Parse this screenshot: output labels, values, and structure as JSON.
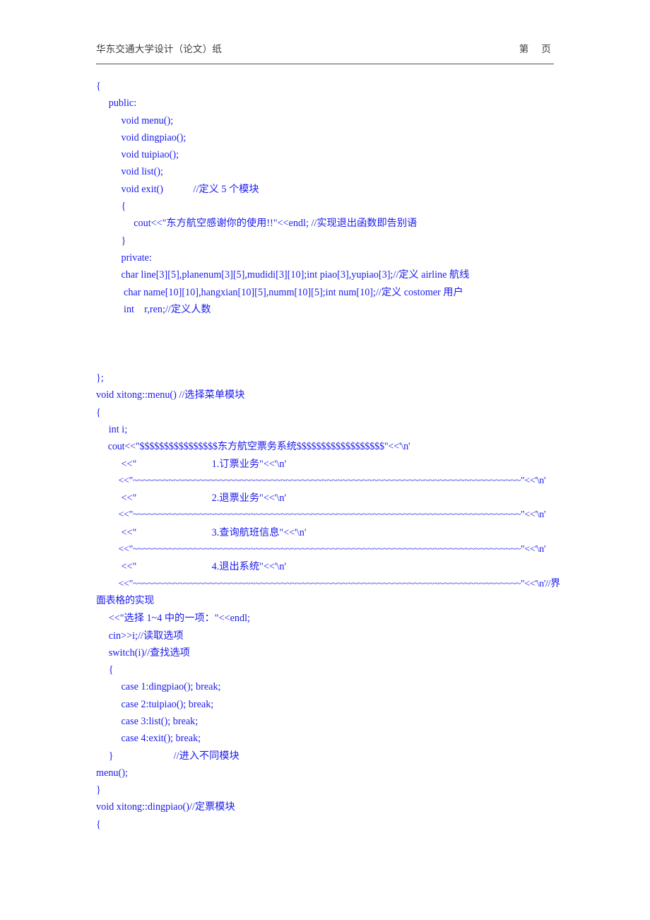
{
  "header": {
    "left_text": "华东交通大学设计（论文）纸",
    "right_text": "第     页"
  },
  "document": {
    "language": "C++",
    "text_color": "#1a1aee",
    "rule_color": "#4d4d4d",
    "lines": [
      "{",
      "     public:",
      "          void menu();",
      "          void dingpiao();",
      "          void tuipiao();",
      "          void list();",
      "          void exit()            //定义 5 个模块",
      "          {",
      "               cout<<\"东方航空感谢你的使用!!\"<<endl; //实现退出函数即告别语",
      "          }",
      "          private:",
      "          char line[3][5],planenum[3][5],mudidi[3][10];int piao[3],yupiao[3];//定义 airline 航线",
      "           char name[10][10],hangxian[10][5],numm[10][5];int num[10];//定义 costomer 用户",
      "           int    r,ren;//定义人数",
      "",
      "",
      "",
      "};",
      "void xitong::menu() //选择菜单模块",
      "{",
      "     int i;",
      "     cout<<\"$$$$$$$$$$$$$$$$东方航空票务系统$$$$$$$$$$$$$$$$$$\"<<'\\n'",
      "          <<\"                              1.订票业务\"<<'\\n'",
      "          <<\"~~~~~~~~~~~~~~~~~~~~~~~~~~~~~~~~~~~~~~~~~~~~~~~~~~~~~~~~~~~~~~~~~~~~~~~~~~~~\"<<'\\n'",
      "          <<\"                              2.退票业务\"<<'\\n'",
      "          <<\"~~~~~~~~~~~~~~~~~~~~~~~~~~~~~~~~~~~~~~~~~~~~~~~~~~~~~~~~~~~~~~~~~~~~~~~~~~~~\"<<'\\n'",
      "          <<\"                              3.查询航班信息\"<<'\\n'",
      "          <<\"~~~~~~~~~~~~~~~~~~~~~~~~~~~~~~~~~~~~~~~~~~~~~~~~~~~~~~~~~~~~~~~~~~~~~~~~~~~~\"<<'\\n'",
      "          <<\"                              4.退出系统\"<<'\\n'",
      "          <<\"~~~~~~~~~~~~~~~~~~~~~~~~~~~~~~~~~~~~~~~~~~~~~~~~~~~~~~~~~~~~~~~~~~~~~~~~~~~~\"<<'\\n'//界面表格的实现",
      "     <<\"选择 1~4 中的一项：\"<<endl;",
      "     cin>>i;//读取选项",
      "     switch(i)//查找选项",
      "     {",
      "          case 1:dingpiao(); break;",
      "          case 2:tuipiao(); break;",
      "          case 3:list(); break;",
      "          case 4:exit(); break;",
      "     }                        //进入不同模块",
      "menu();",
      "}",
      "void xitong::dingpiao()//定票模块",
      "{"
    ],
    "line_styles": [
      "",
      "",
      "",
      "",
      "",
      "",
      "",
      "",
      "",
      "",
      "",
      "wrap",
      "wrap",
      "",
      "blank",
      "blank",
      "blank",
      "",
      "",
      "",
      "",
      "title-line",
      "",
      "rule-line",
      "",
      "rule-line",
      "",
      "rule-line",
      "",
      "wrap-rule",
      "",
      "",
      "",
      "",
      "",
      "",
      "",
      "",
      "",
      "",
      "",
      "",
      ""
    ]
  }
}
